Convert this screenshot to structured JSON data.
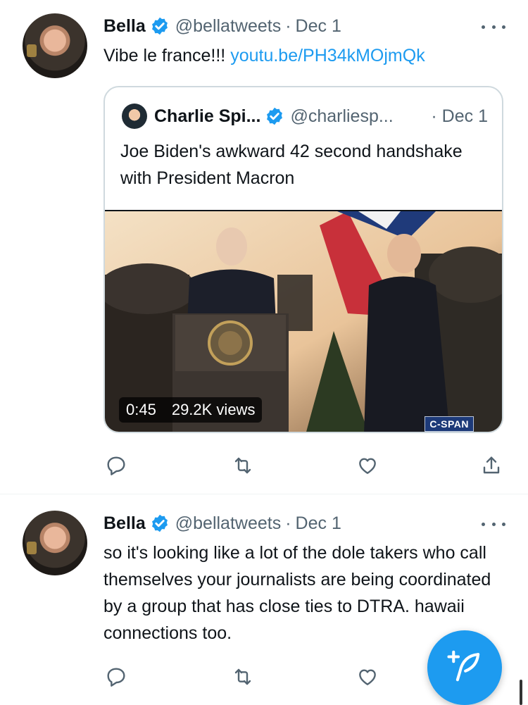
{
  "tweets": [
    {
      "name": "Bella",
      "handle": "@bellatweets",
      "sep": "·",
      "date": "Dec 1",
      "text_plain": "Vibe le france!!! ",
      "text_link": "youtu.be/PH34kMOjmQk",
      "quote": {
        "name": "Charlie Spi...",
        "handle": "@charliesp...",
        "date": "· Dec 1",
        "text": "Joe Biden's awkward 42 second handshake with President Macron",
        "video": {
          "duration": "0:45",
          "views": "29.2K views",
          "watermark": "C-SPAN"
        }
      }
    },
    {
      "name": "Bella",
      "handle": "@bellatweets",
      "sep": "·",
      "date": "Dec 1",
      "text": "so it's looking like a lot of the dole takers who call themselves your journalists are being coordinated by a group that has close ties to DTRA. hawaii connections too."
    }
  ],
  "icons": {
    "verified": "verified-badge-icon",
    "reply": "reply-icon",
    "retweet": "retweet-icon",
    "like": "heart-icon",
    "share": "share-icon",
    "more": "more-horizontal-icon",
    "compose": "compose-tweet-icon"
  },
  "colors": {
    "accent": "#1d9bf0",
    "text": "#0f1419",
    "muted": "#536471",
    "border": "#cfd9de"
  }
}
